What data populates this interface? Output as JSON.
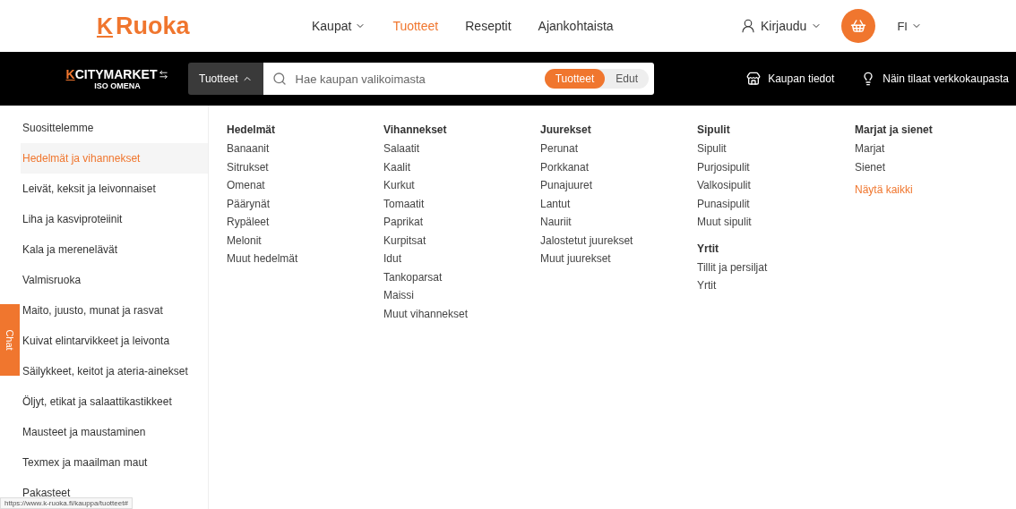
{
  "header": {
    "logo": {
      "mark": "K",
      "text": "Ruoka"
    },
    "nav": [
      {
        "label": "Kaupat",
        "selected": false,
        "dropdown": true
      },
      {
        "label": "Tuotteet",
        "selected": true,
        "dropdown": false
      },
      {
        "label": "Reseptit",
        "selected": false,
        "dropdown": false
      },
      {
        "label": "Ajankohtaista",
        "selected": false,
        "dropdown": false
      }
    ],
    "login": "Kirjaudu",
    "language": "FI"
  },
  "store_bar": {
    "store_mark": "K",
    "store_name": "CITYMARKET",
    "store_location": "ISO OMENA",
    "scope_button": "Tuotteet",
    "search": {
      "placeholder": "Hae kaupan valikoimasta"
    },
    "toggle": [
      {
        "label": "Tuotteet",
        "selected": true
      },
      {
        "label": "Edut",
        "selected": false
      }
    ],
    "links": [
      "Kaupan tiedot",
      "Näin tilaat verkkokaupasta"
    ]
  },
  "sidebar": {
    "items": [
      {
        "label": "Suosittelemme",
        "selected": false
      },
      {
        "label": "Hedelmät ja vihannekset",
        "selected": true
      },
      {
        "label": "Leivät, keksit ja leivonnaiset",
        "selected": false
      },
      {
        "label": "Liha ja kasviproteiinit",
        "selected": false
      },
      {
        "label": "Kala ja merenelävät",
        "selected": false
      },
      {
        "label": "Valmisruoka",
        "selected": false
      },
      {
        "label": "Maito, juusto, munat ja rasvat",
        "selected": false
      },
      {
        "label": "Kuivat elintarvikkeet ja leivonta",
        "selected": false
      },
      {
        "label": "Säilykkeet, keitot ja ateria-ainekset",
        "selected": false
      },
      {
        "label": "Öljyt, etikat ja salaattikastikkeet",
        "selected": false
      },
      {
        "label": "Mausteet ja maustaminen",
        "selected": false
      },
      {
        "label": "Texmex ja maailman maut",
        "selected": false
      },
      {
        "label": "Pakasteet",
        "selected": false
      }
    ]
  },
  "chat_tab": "Chat",
  "menu_columns": [
    {
      "groups": [
        {
          "heading": "Hedelmät",
          "items": [
            "Banaanit",
            "Sitrukset",
            "Omenat",
            "Päärynät",
            "Rypäleet",
            "Melonit",
            "Muut hedelmät"
          ]
        }
      ]
    },
    {
      "groups": [
        {
          "heading": "Vihannekset",
          "items": [
            "Salaatit",
            "Kaalit",
            "Kurkut",
            "Tomaatit",
            "Paprikat",
            "Kurpitsat",
            "Idut",
            "Tankoparsat",
            "Maissi",
            "Muut vihannekset"
          ]
        }
      ]
    },
    {
      "groups": [
        {
          "heading": "Juurekset",
          "items": [
            "Perunat",
            "Porkkanat",
            "Punajuuret",
            "Lantut",
            "Nauriit",
            "Jalostetut juurekset",
            "Muut juurekset"
          ]
        }
      ]
    },
    {
      "groups": [
        {
          "heading": "Sipulit",
          "items": [
            "Sipulit",
            "Purjosipulit",
            "Valkosipulit",
            "Punasipulit",
            "Muut sipulit"
          ]
        },
        {
          "heading": "Yrtit",
          "items": [
            "Tillit ja persiljat",
            "Yrtit"
          ]
        }
      ]
    },
    {
      "groups": [
        {
          "heading": "Marjat ja sienet",
          "items": [
            "Marjat",
            "Sienet"
          ]
        }
      ],
      "show_all": "Näytä kaikki"
    }
  ],
  "status_url": "https://www.k-ruoka.fi/kauppa/tuotteet#"
}
